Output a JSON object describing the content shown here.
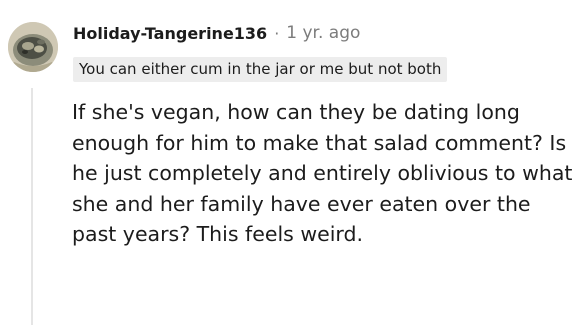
{
  "comment": {
    "author": "Holiday-Tangerine136",
    "separator": "·",
    "timestamp": "1 yr. ago",
    "flair": "You can either cum in the jar or me but not both",
    "body": "If she's vegan, how can they be dating long enough for him to make that salad comment? Is he just completely and entirely oblivious to what she and her family have ever eaten over the past years? This feels weird."
  }
}
